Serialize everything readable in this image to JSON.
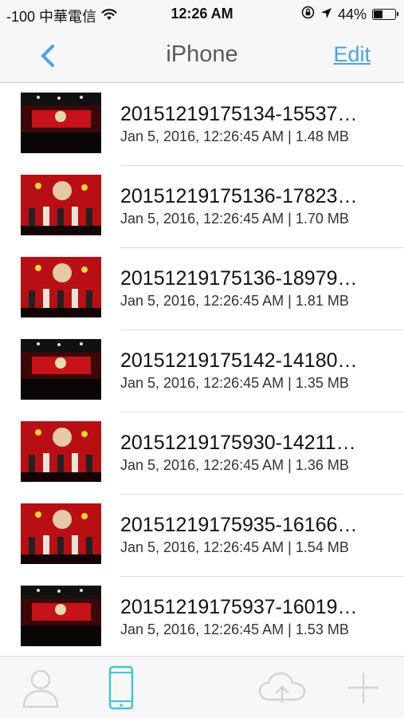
{
  "status_bar": {
    "carrier": "-100 中華電信",
    "time": "12:26 AM",
    "battery": "44%",
    "battery_level": 0.44
  },
  "nav": {
    "title": "iPhone",
    "edit_label": "Edit"
  },
  "files": [
    {
      "name": "20151219175134-15537…",
      "date": "Jan 5, 2016, 12:26:45 AM",
      "size": "1.48 MB"
    },
    {
      "name": "20151219175136-17823…",
      "date": "Jan 5, 2016, 12:26:45 AM",
      "size": "1.70 MB"
    },
    {
      "name": "20151219175136-18979…",
      "date": "Jan 5, 2016, 12:26:45 AM",
      "size": "1.81 MB"
    },
    {
      "name": "20151219175142-14180…",
      "date": "Jan 5, 2016, 12:26:45 AM",
      "size": "1.35 MB"
    },
    {
      "name": "20151219175930-14211…",
      "date": "Jan 5, 2016, 12:26:45 AM",
      "size": "1.36 MB"
    },
    {
      "name": "20151219175935-16166…",
      "date": "Jan 5, 2016, 12:26:45 AM",
      "size": "1.54 MB"
    },
    {
      "name": "20151219175937-16019…",
      "date": "Jan 5, 2016, 12:26:45 AM",
      "size": "1.53 MB"
    }
  ],
  "tabs": [
    {
      "icon": "person-icon",
      "active": false
    },
    {
      "icon": "phone-icon",
      "active": true
    },
    {
      "icon": "cloud-upload-icon",
      "active": false
    },
    {
      "icon": "plus-icon",
      "active": false
    }
  ],
  "colors": {
    "accent": "#4aa3e8",
    "active_tab": "#3ec6d6",
    "inactive_tab": "#d4d4d4"
  }
}
